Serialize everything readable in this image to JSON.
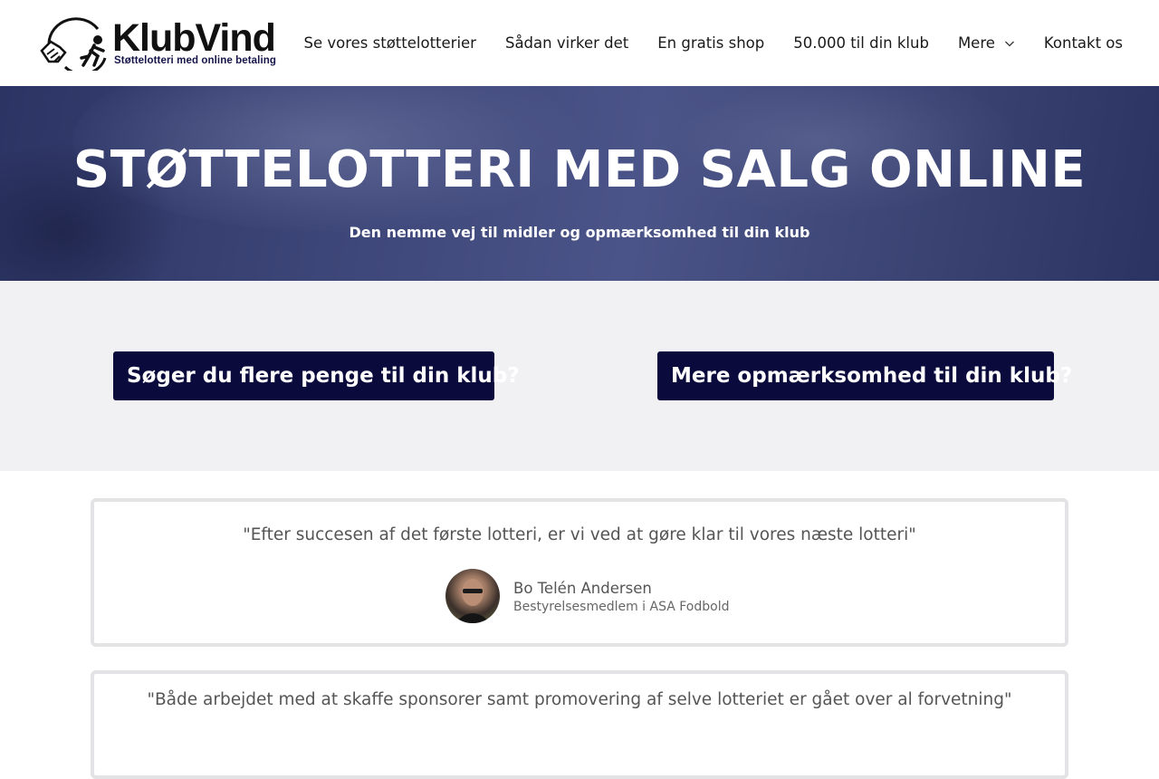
{
  "brand": {
    "name": "KlubVind",
    "tagline": "Støttelotteri med online betaling"
  },
  "nav": {
    "items": [
      {
        "label": "Se vores støttelotterier"
      },
      {
        "label": "Sådan virker det"
      },
      {
        "label": "En gratis shop"
      },
      {
        "label": "50.000 til din klub"
      },
      {
        "label": "Mere",
        "has_dropdown": true
      },
      {
        "label": "Kontakt os"
      }
    ]
  },
  "hero": {
    "title": "STØTTELOTTERI MED SALG ONLINE",
    "subtitle": "Den nemme vej til midler og opmærksomhed til din klub"
  },
  "cta": {
    "left": "Søger du flere penge til din klub?",
    "right": "Mere opmærksomhed til din klub?"
  },
  "testimonials": [
    {
      "quote": "\"Efter succesen af det første lotteri, er vi ved at gøre klar til vores næste lotteri\"",
      "name": "Bo Telén Andersen",
      "role": "Bestyrelsesmedlem i ASA Fodbold"
    },
    {
      "quote": "\"Både arbejdet med at skaffe sponsorer samt promovering af selve lotteriet er gået over al forvetning\""
    }
  ],
  "colors": {
    "cta_background": "#0a0a3c",
    "band_background": "#f1f1f4",
    "hero_overlay": "#3d4678"
  }
}
